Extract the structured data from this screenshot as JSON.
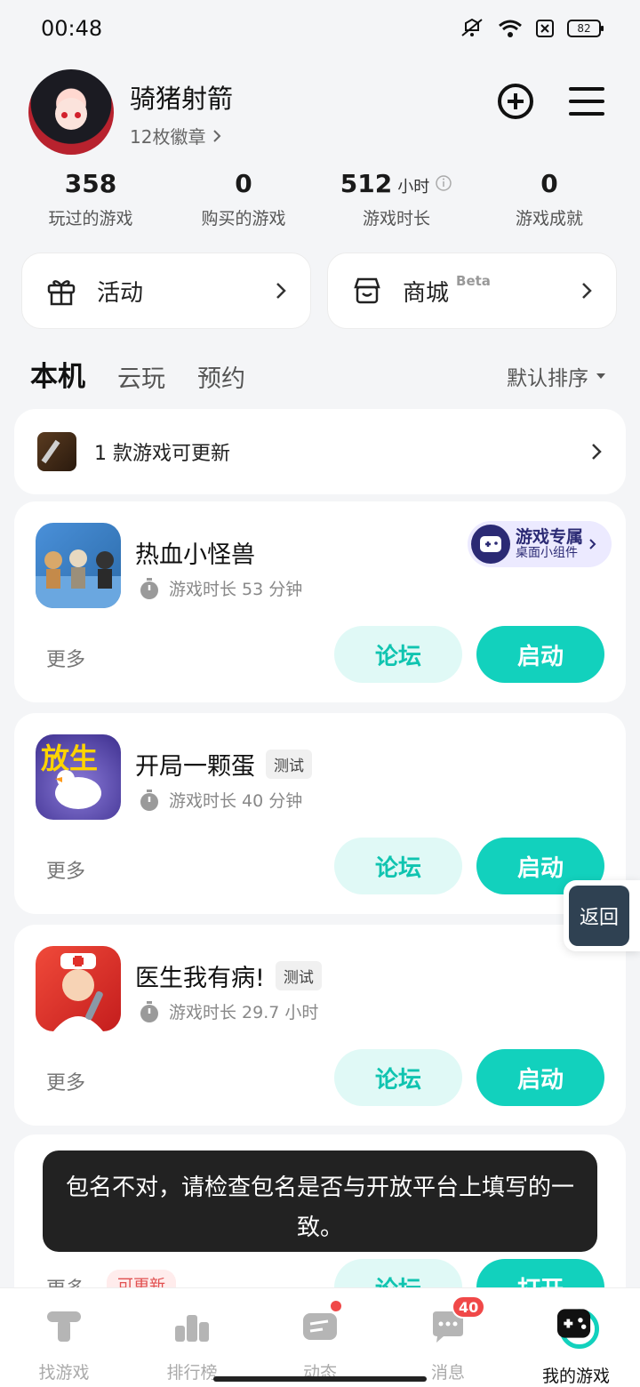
{
  "status_bar": {
    "time": "00:48",
    "battery": "82"
  },
  "profile": {
    "name": "骑猪射箭",
    "badges": "12枚徽章",
    "stats": [
      {
        "value": "358",
        "unit": "",
        "label": "玩过的游戏"
      },
      {
        "value": "0",
        "unit": "",
        "label": "购买的游戏"
      },
      {
        "value": "512",
        "unit": "小时",
        "label": "游戏时长"
      },
      {
        "value": "0",
        "unit": "",
        "label": "游戏成就"
      }
    ]
  },
  "entries": {
    "activity": "活动",
    "shop": "商城",
    "shop_tag": "Beta"
  },
  "tabs": [
    "本机",
    "云玩",
    "预约"
  ],
  "sort_label": "默认排序",
  "update_banner": "1 款游戏可更新",
  "games": [
    {
      "title": "热血小怪兽",
      "tag": "",
      "playtime": "游戏时长 53 分钟",
      "more": "更多",
      "forum": "论坛",
      "launch": "启动"
    },
    {
      "title": "开局一颗蛋",
      "tag": "测试",
      "playtime": "游戏时长 40 分钟",
      "more": "更多",
      "forum": "论坛",
      "launch": "启动"
    },
    {
      "title": "医生我有病!",
      "tag": "测试",
      "playtime": "游戏时长 29.7 小时",
      "more": "更多",
      "forum": "论坛",
      "launch": "启动"
    }
  ],
  "widget_badge": {
    "title": "游戏专属",
    "sub": "桌面小组件"
  },
  "back_float": "返回",
  "card4": {
    "more": "更多",
    "tag": "可更新",
    "forum": "论坛",
    "open": "打开"
  },
  "toast": "包名不对，请检查包名是否与开放平台上填写的一致。",
  "bottom_nav": [
    {
      "label": "找游戏",
      "icon": "find-game-icon"
    },
    {
      "label": "排行榜",
      "icon": "ranking-icon"
    },
    {
      "label": "动态",
      "icon": "feed-icon"
    },
    {
      "label": "消息",
      "icon": "message-icon",
      "badge": "40"
    },
    {
      "label": "我的游戏",
      "icon": "my-games-icon"
    }
  ],
  "colors": {
    "accent": "#12d1bd",
    "accent_light": "#e0f9f6",
    "badge_red": "#f04848"
  }
}
